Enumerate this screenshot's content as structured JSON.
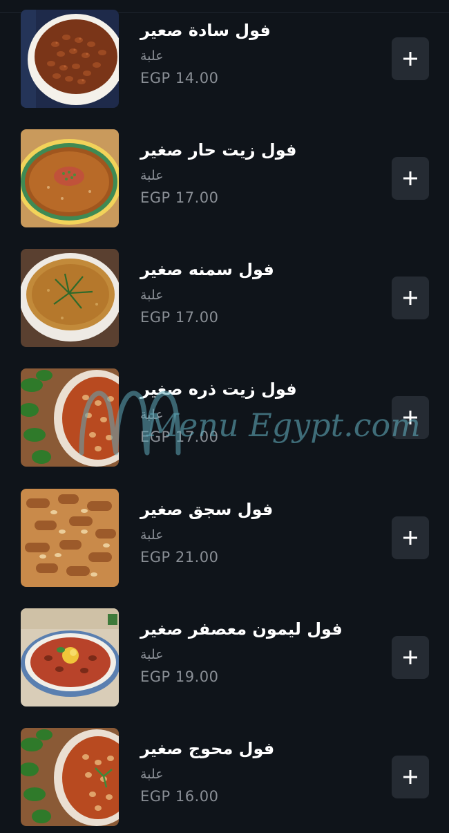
{
  "colors": {
    "background": "#0f141a",
    "button_bg": "#252b33",
    "secondary_text": "#8a8f96",
    "watermark": "#5fa8b8"
  },
  "watermark": {
    "text": "Menu Egypt.com"
  },
  "items": [
    {
      "name": "فول سادة صعير",
      "unit": "علبة",
      "price": "EGP 14.00",
      "image": "plain-fava-beans-bowl",
      "add_icon": "plus-icon"
    },
    {
      "name": "فول زيت حار صغير",
      "unit": "علبة",
      "price": "EGP 17.00",
      "image": "hot-oil-fava-beans-plate",
      "add_icon": "plus-icon"
    },
    {
      "name": "فول سمنه صغير",
      "unit": "علبة",
      "price": "EGP 17.00",
      "image": "ghee-fava-beans-bowl",
      "add_icon": "plus-icon"
    },
    {
      "name": "فول زيت ذره صغير",
      "unit": "علبة",
      "price": "EGP 17.00",
      "image": "corn-oil-fava-beans-dish",
      "add_icon": "plus-icon"
    },
    {
      "name": "فول سجق صغير",
      "unit": "علبة",
      "price": "EGP 21.00",
      "image": "sausage-fava-beans",
      "add_icon": "plus-icon"
    },
    {
      "name": "فول ليمون معصفر صغير",
      "unit": "علبة",
      "price": "EGP 19.00",
      "image": "lemon-fava-beans-bowl",
      "add_icon": "plus-icon"
    },
    {
      "name": "فول محوج صغير",
      "unit": "علبة",
      "price": "EGP 16.00",
      "image": "spiced-fava-beans-dish",
      "add_icon": "plus-icon"
    }
  ]
}
